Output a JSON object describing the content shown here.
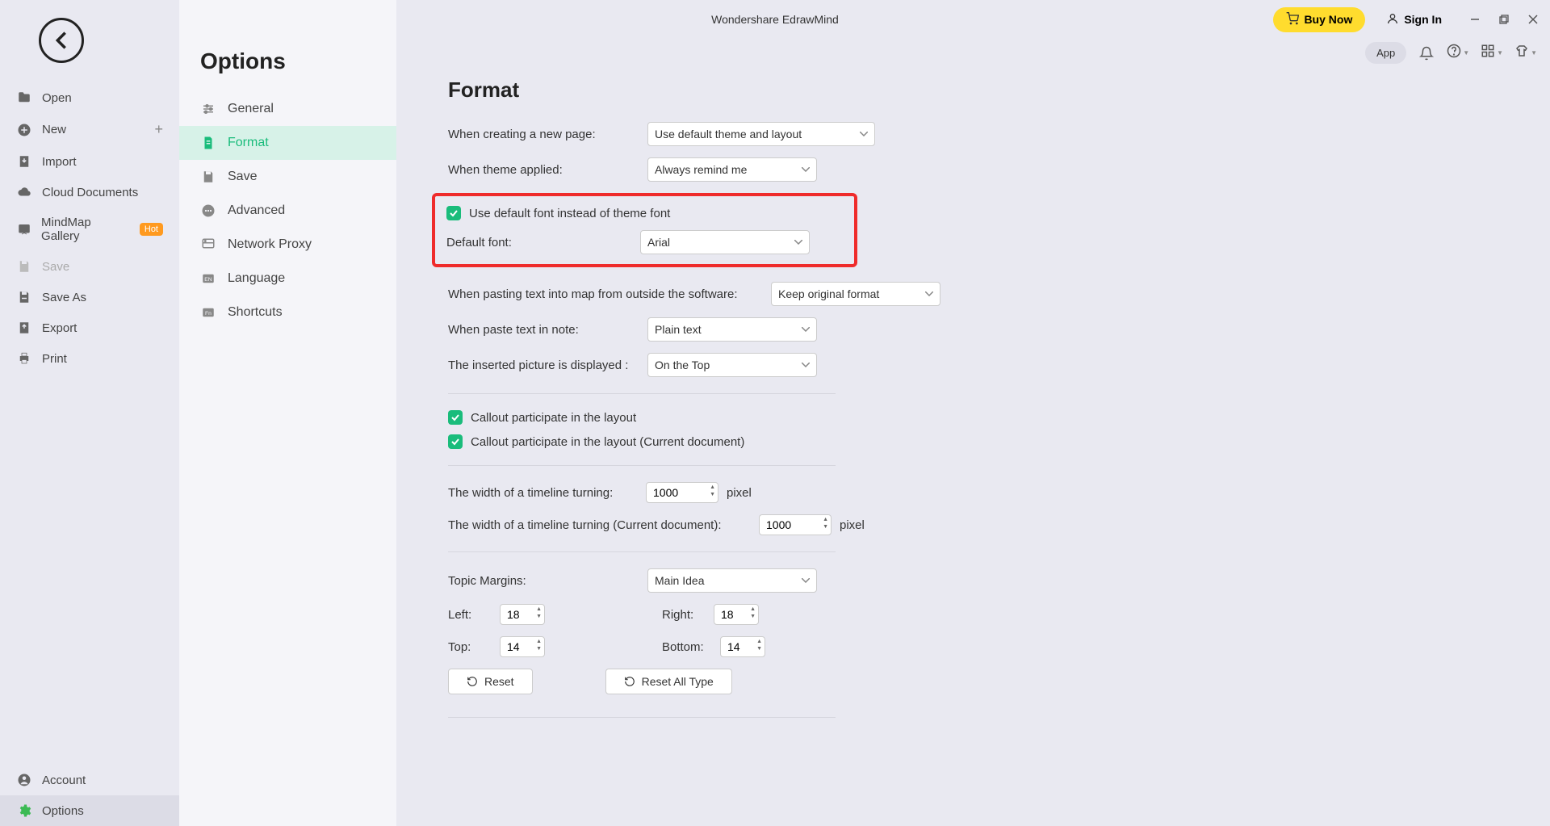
{
  "titlebar": {
    "app_title": "Wondershare EdrawMind",
    "buy_now": "Buy Now",
    "sign_in": "Sign In"
  },
  "app_pill": "App",
  "left_sidebar": {
    "items": [
      {
        "label": "Open"
      },
      {
        "label": "New"
      },
      {
        "label": "Import"
      },
      {
        "label": "Cloud Documents"
      },
      {
        "label": "MindMap Gallery",
        "hot": "Hot"
      },
      {
        "label": "Save"
      },
      {
        "label": "Save As"
      },
      {
        "label": "Export"
      },
      {
        "label": "Print"
      }
    ],
    "bottom": {
      "account": "Account",
      "options": "Options"
    }
  },
  "options_panel": {
    "title": "Options",
    "items": [
      {
        "label": "General"
      },
      {
        "label": "Format"
      },
      {
        "label": "Save"
      },
      {
        "label": "Advanced"
      },
      {
        "label": "Network Proxy"
      },
      {
        "label": "Language"
      },
      {
        "label": "Shortcuts"
      }
    ]
  },
  "format": {
    "heading": "Format",
    "new_page_label": "When creating a new page:",
    "new_page_value": "Use default theme and layout",
    "theme_applied_label": "When theme applied:",
    "theme_applied_value": "Always remind me",
    "default_font_check": "Use default font instead of theme font",
    "default_font_label": "Default font:",
    "default_font_value": "Arial",
    "paste_map_label": "When pasting text into map from outside the software:",
    "paste_map_value": "Keep original format",
    "paste_note_label": "When paste text in note:",
    "paste_note_value": "Plain text",
    "picture_label": "The inserted picture is displayed :",
    "picture_value": "On the Top",
    "callout_layout": "Callout participate in the layout",
    "callout_layout_doc": "Callout participate in the layout (Current document)",
    "timeline_width_label": "The width of a timeline turning:",
    "timeline_width_value": "1000",
    "timeline_width_doc_label": "The width of a timeline turning (Current document):",
    "timeline_width_doc_value": "1000",
    "pixel": "pixel",
    "topic_margins_label": "Topic Margins:",
    "topic_margins_value": "Main Idea",
    "left_label": "Left:",
    "left_value": "18",
    "right_label": "Right:",
    "right_value": "18",
    "top_label": "Top:",
    "top_value": "14",
    "bottom_label": "Bottom:",
    "bottom_value": "14",
    "reset": "Reset",
    "reset_all": "Reset All Type"
  }
}
